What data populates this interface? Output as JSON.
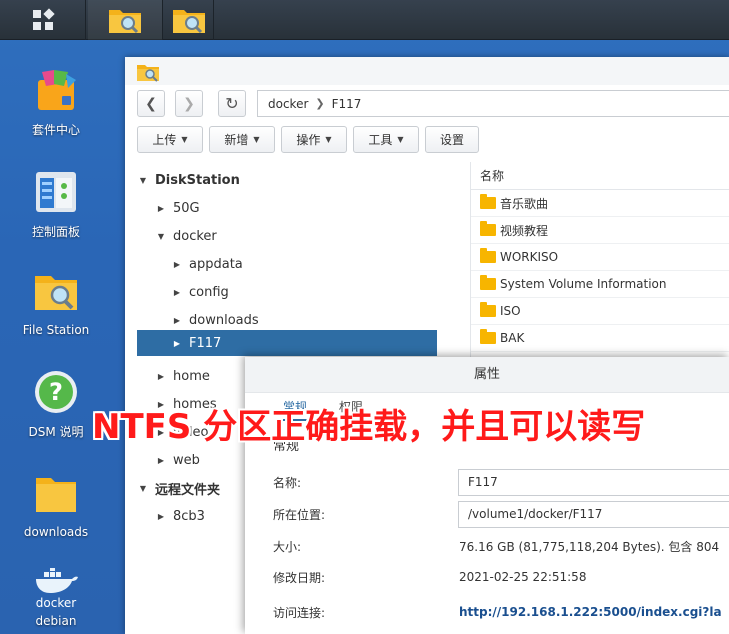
{
  "desktop": {
    "icons": [
      {
        "label": "套件中心",
        "icon": "package-center-icon"
      },
      {
        "label": "控制面板",
        "icon": "control-panel-icon"
      },
      {
        "label": "File Station",
        "icon": "file-station-icon"
      },
      {
        "label": "DSM 说明",
        "icon": "help-icon"
      },
      {
        "label": "downloads",
        "icon": "folder-icon"
      },
      {
        "label": "debian",
        "icon": "docker-icon",
        "logo_text": "docker"
      }
    ]
  },
  "window": {
    "path": {
      "segments": [
        "docker",
        "F117"
      ]
    },
    "toolbar": {
      "upload": "上传",
      "create": "新增",
      "action": "操作",
      "tools": "工具",
      "settings": "设置"
    },
    "tree": [
      {
        "label": "DiskStation",
        "level": 0,
        "expanded": true,
        "bold": true
      },
      {
        "label": "50G",
        "level": 1,
        "expanded": false
      },
      {
        "label": "docker",
        "level": 1,
        "expanded": true
      },
      {
        "label": "appdata",
        "level": 2,
        "expanded": false
      },
      {
        "label": "config",
        "level": 2,
        "expanded": false
      },
      {
        "label": "downloads",
        "level": 2,
        "expanded": false
      },
      {
        "label": "F117",
        "level": 2,
        "expanded": false,
        "selected": true
      },
      {
        "label": "home",
        "level": 1,
        "expanded": false
      },
      {
        "label": "homes",
        "level": 1,
        "expanded": false
      },
      {
        "label": "video",
        "level": 1,
        "expanded": false
      },
      {
        "label": "web",
        "level": 1,
        "expanded": false
      },
      {
        "label": "远程文件夹",
        "level": 0,
        "expanded": true,
        "bold": true
      },
      {
        "label": "8cb3",
        "level": 1,
        "expanded": false
      }
    ],
    "file_list": {
      "header": "名称",
      "items": [
        "音乐歌曲",
        "视频教程",
        "WORKISO",
        "System Volume Information",
        "ISO",
        "BAK"
      ]
    }
  },
  "dialog": {
    "title": "属性",
    "tabs": [
      "常规",
      "权限"
    ],
    "section": "常规",
    "rows": [
      {
        "key": "名称:",
        "value": "F117",
        "field": true
      },
      {
        "key": "所在位置:",
        "value": "/volume1/docker/F117",
        "field": true
      },
      {
        "key": "大小:",
        "value": "76.16 GB (81,775,118,204 Bytes). 包含 804"
      },
      {
        "key": "修改日期:",
        "value": "2021-02-25 22:51:58"
      },
      {
        "key": "访问连接:",
        "value": "http://192.168.1.222:5000/index.cgi?la",
        "link": true
      }
    ]
  },
  "overlay": {
    "text": "NTFS 分区正确挂载，并且可以读写"
  },
  "colors": {
    "accent": "#2e6da4",
    "folder": "#f7b500",
    "annotation": "#ff1a1a"
  }
}
